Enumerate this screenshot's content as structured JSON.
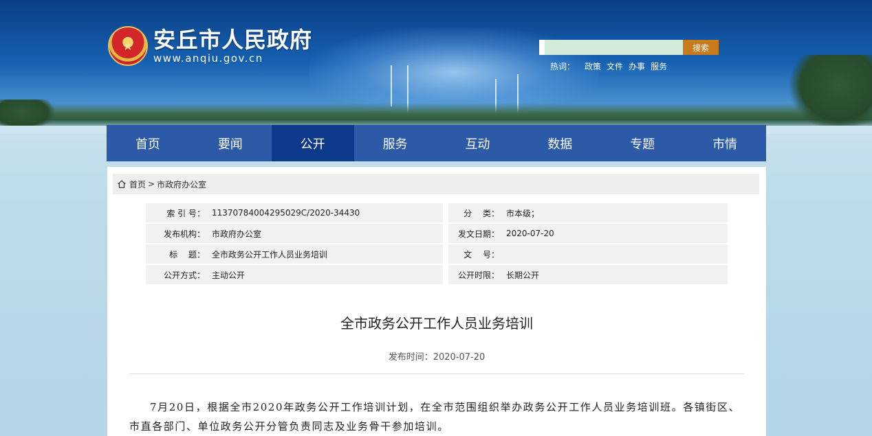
{
  "header": {
    "site_title": "安丘市人民政府",
    "site_url": "www.anqiu.gov.cn",
    "search": {
      "placeholder": "",
      "button_label": "搜索"
    },
    "hotwords": {
      "label": "热词：",
      "items": [
        "政策",
        "文件",
        "办事",
        "服务"
      ]
    }
  },
  "nav": {
    "items": [
      "首页",
      "要闻",
      "公开",
      "服务",
      "互动",
      "数据",
      "专题",
      "市情"
    ],
    "active_index": 2
  },
  "breadcrumb": {
    "home": "首页",
    "separator": ">",
    "current": "市政府办公室"
  },
  "meta": {
    "rows": [
      {
        "k1": "索 引 号：",
        "v1": "11370784004295029C/2020-34430",
        "k2": "分　 类：",
        "v2": "市本级；"
      },
      {
        "k1": "发布机构：",
        "v1": "市政府办公室",
        "k2": "发文日期：",
        "v2": "2020-07-20"
      },
      {
        "k1": "标　 题：",
        "v1": "全市政务公开工作人员业务培训",
        "k2": "文　 号：",
        "v2": ""
      },
      {
        "k1": "公开方式：",
        "v1": "主动公开",
        "k2": "公开时限：",
        "v2": "长期公开"
      }
    ]
  },
  "article": {
    "title": "全市政务公开工作人员业务培训",
    "pubtime": "发布时间：2020-07-20",
    "body": "7月20日，根据全市2020年政务公开工作培训计划，在全市范围组织举办政务公开工作人员业务培训班。各镇街区、市直各部门、单位政务公开分管负责同志及业务骨干参加培训。"
  },
  "colors": {
    "nav_bg": "#2d5aa7",
    "nav_active": "#0e3a8c",
    "search_button": "#c87a1c"
  }
}
